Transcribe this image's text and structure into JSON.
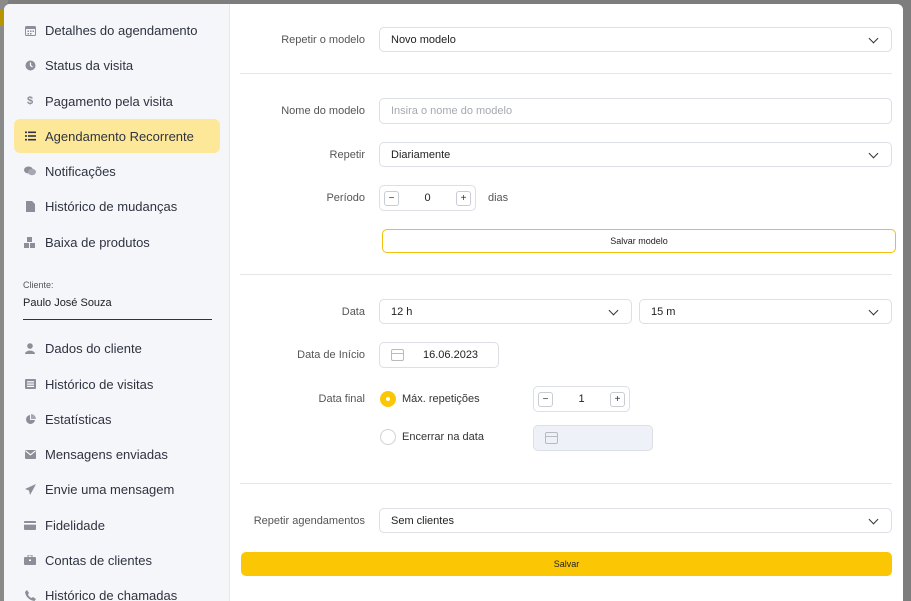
{
  "sidebar": {
    "items": [
      {
        "label": "Detalhes do agendamento",
        "icon": "calendar-icon"
      },
      {
        "label": "Status da visita",
        "icon": "clock-icon"
      },
      {
        "label": "Pagamento pela visita",
        "icon": "dollar-icon"
      },
      {
        "label": "Agendamento Recorrente",
        "icon": "list-icon",
        "active": true
      },
      {
        "label": "Notificações",
        "icon": "chat-icon"
      },
      {
        "label": "Histórico de mudanças",
        "icon": "document-icon"
      },
      {
        "label": "Baixa de produtos",
        "icon": "boxes-icon"
      }
    ],
    "client_label": "Cliente:",
    "client_value": "Paulo  José Souza",
    "client_items": [
      {
        "label": "Dados do cliente",
        "icon": "user-icon"
      },
      {
        "label": "Histórico de visitas",
        "icon": "list-box-icon"
      },
      {
        "label": "Estatísticas",
        "icon": "pie-chart-icon"
      },
      {
        "label": "Mensagens enviadas",
        "icon": "envelope-icon"
      },
      {
        "label": "Envie uma mensagem",
        "icon": "paper-plane-icon"
      },
      {
        "label": "Fidelidade",
        "icon": "credit-card-icon"
      },
      {
        "label": "Contas de clientes",
        "icon": "briefcase-icon"
      },
      {
        "label": "Histórico de chamadas",
        "icon": "phone-icon"
      }
    ]
  },
  "form": {
    "repeat_model_label": "Repetir o modelo",
    "repeat_model_value": "Novo modelo",
    "model_name_label": "Nome do modelo",
    "model_name_placeholder": "Insira o nome do modelo",
    "repeat_label": "Repetir",
    "repeat_value": "Diariamente",
    "period_label": "Período",
    "period_value": "0",
    "period_unit": "dias",
    "save_model_label": "Salvar modelo",
    "date_label": "Data",
    "hour_value": "12 h",
    "minute_value": "15 m",
    "start_date_label": "Data de Início",
    "start_date_value": "16.06.2023",
    "end_date_label": "Data final",
    "max_reps_label": "Máx. repetições",
    "max_reps_value": "1",
    "end_on_date_label": "Encerrar na data",
    "repeat_appointments_label": "Repetir agendamentos",
    "repeat_appointments_value": "Sem clientes",
    "save_label": "Salvar",
    "minus": "−",
    "plus": "+"
  },
  "colors": {
    "accent": "#fbc705",
    "active_bg": "#fde89a",
    "sidebar_bg": "#f4f6fa"
  }
}
